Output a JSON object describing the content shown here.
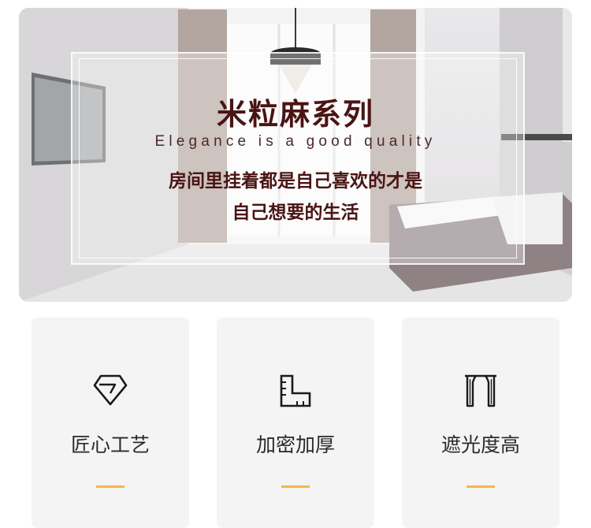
{
  "hero": {
    "title": "米粒麻系列",
    "subtitle": "Elegance is a good quality",
    "description_line1": "房间里挂着都是自己喜欢的才是",
    "description_line2": "自己想要的生活"
  },
  "features": [
    {
      "label": "匠心工艺",
      "icon": "diamond-icon"
    },
    {
      "label": "加密加厚",
      "icon": "ruler-icon"
    },
    {
      "label": "遮光度高",
      "icon": "curtain-icon"
    }
  ],
  "colors": {
    "title": "#4a1414",
    "accent_bar": "#f5b64a",
    "card_background": "#f4f4f4"
  }
}
